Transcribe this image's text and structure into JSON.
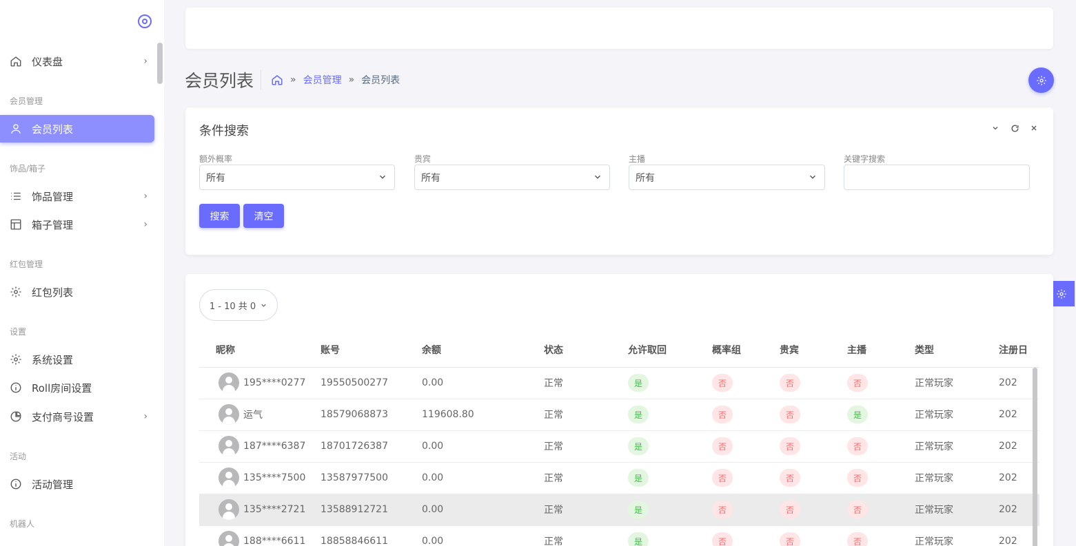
{
  "sidebar": {
    "sections": [
      {
        "header": "",
        "items": [
          {
            "label": "仪表盘",
            "icon": "home-icon",
            "chevron": true
          }
        ]
      },
      {
        "header": "会员管理",
        "items": [
          {
            "label": "会员列表",
            "icon": "user-icon",
            "active": true
          }
        ]
      },
      {
        "header": "饰品/箱子",
        "items": [
          {
            "label": "饰品管理",
            "icon": "list-icon",
            "chevron": true
          },
          {
            "label": "箱子管理",
            "icon": "layout-icon",
            "chevron": true
          }
        ]
      },
      {
        "header": "红包管理",
        "items": [
          {
            "label": "红包列表",
            "icon": "gear-icon"
          }
        ]
      },
      {
        "header": "设置",
        "items": [
          {
            "label": "系统设置",
            "icon": "gear-icon"
          },
          {
            "label": "Roll房间设置",
            "icon": "info-icon"
          },
          {
            "label": "支付商号设置",
            "icon": "pie-chart-icon",
            "chevron": true
          }
        ]
      },
      {
        "header": "活动",
        "items": [
          {
            "label": "活动管理",
            "icon": "info-icon"
          }
        ]
      },
      {
        "header": "机器人",
        "items": []
      }
    ]
  },
  "page": {
    "title": "会员列表",
    "breadcrumb": {
      "link": "会员管理",
      "current": "会员列表",
      "separator": "»"
    }
  },
  "search": {
    "title": "条件搜索",
    "fields": [
      {
        "label": "额外概率",
        "value": "所有"
      },
      {
        "label": "贵宾",
        "value": "所有"
      },
      {
        "label": "主播",
        "value": "所有"
      }
    ],
    "keyword_label": "关键字搜索",
    "keyword_value": "",
    "search_button": "搜索",
    "clear_button": "清空"
  },
  "table": {
    "pager": "1 - 10 共 0",
    "columns": [
      "昵称",
      "账号",
      "余额",
      "状态",
      "允许取回",
      "概率组",
      "贵宾",
      "主播",
      "类型",
      "注册日"
    ],
    "rows": [
      {
        "nickname": "195****0277",
        "account": "19550500277",
        "balance": "0.00",
        "status": "正常",
        "allow_retrieve": "是",
        "prob_group": "否",
        "vip": "否",
        "anchor": "否",
        "type": "正常玩家",
        "reg": "202"
      },
      {
        "nickname": "运气",
        "account": "18579068873",
        "balance": "119608.80",
        "status": "正常",
        "allow_retrieve": "是",
        "prob_group": "否",
        "vip": "否",
        "anchor": "是",
        "type": "正常玩家",
        "reg": "202"
      },
      {
        "nickname": "187****6387",
        "account": "18701726387",
        "balance": "0.00",
        "status": "正常",
        "allow_retrieve": "是",
        "prob_group": "否",
        "vip": "否",
        "anchor": "否",
        "type": "正常玩家",
        "reg": "202"
      },
      {
        "nickname": "135****7500",
        "account": "13587977500",
        "balance": "0.00",
        "status": "正常",
        "allow_retrieve": "是",
        "prob_group": "否",
        "vip": "否",
        "anchor": "否",
        "type": "正常玩家",
        "reg": "202"
      },
      {
        "nickname": "135****2721",
        "account": "13588912721",
        "balance": "0.00",
        "status": "正常",
        "allow_retrieve": "是",
        "prob_group": "否",
        "vip": "否",
        "anchor": "否",
        "type": "正常玩家",
        "reg": "202"
      },
      {
        "nickname": "188****6611",
        "account": "18858846611",
        "balance": "0.00",
        "status": "正常",
        "allow_retrieve": "是",
        "prob_group": "否",
        "vip": "否",
        "anchor": "否",
        "type": "正常玩家",
        "reg": "202"
      }
    ]
  },
  "colors": {
    "accent": "#696cff",
    "yes_text": "#3fbf49",
    "no_text": "#ff6b6b"
  }
}
